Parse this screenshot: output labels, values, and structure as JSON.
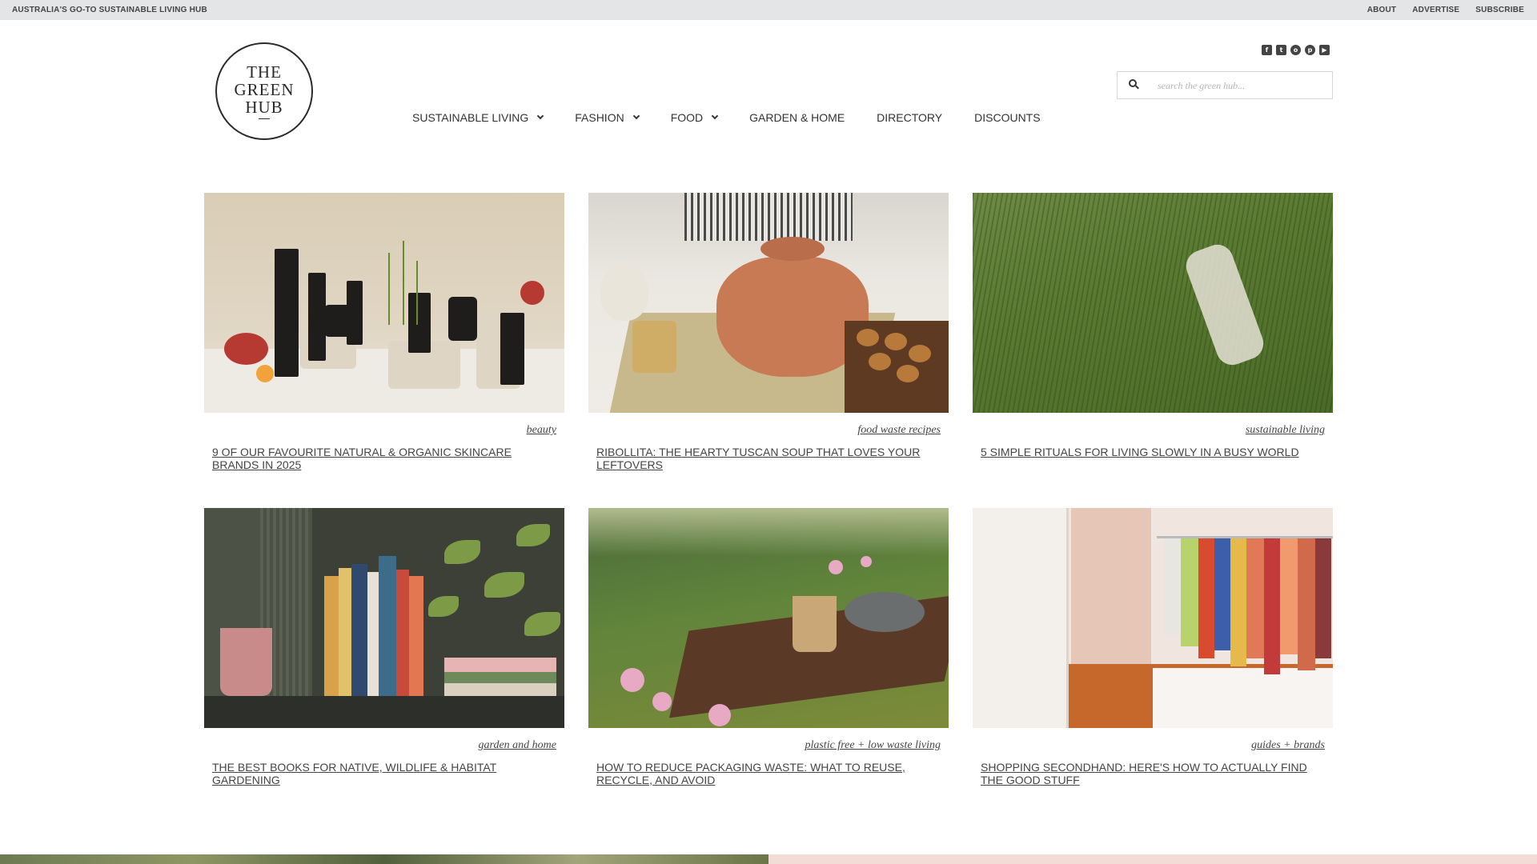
{
  "topbar": {
    "tagline": "AUSTRALIA'S GO-TO SUSTAINABLE LIVING HUB",
    "links": [
      "ABOUT",
      "ADVERTISE",
      "SUBSCRIBE"
    ]
  },
  "logo": {
    "line1": "THE",
    "line2": "GREEN",
    "line3": "HUB"
  },
  "social": [
    "facebook-icon",
    "twitter-icon",
    "instagram-icon",
    "pinterest-icon",
    "youtube-icon"
  ],
  "search": {
    "placeholder": "search the green hub..."
  },
  "nav": {
    "items": [
      {
        "label": "SUSTAINABLE LIVING",
        "has_dropdown": true
      },
      {
        "label": "FASHION",
        "has_dropdown": true
      },
      {
        "label": "FOOD",
        "has_dropdown": true
      },
      {
        "label": "GARDEN & HOME",
        "has_dropdown": false
      },
      {
        "label": "DIRECTORY",
        "has_dropdown": false
      },
      {
        "label": "DISCOUNTS",
        "has_dropdown": false
      }
    ]
  },
  "articles": [
    {
      "category": "beauty",
      "title": "9 OF OUR FAVOURITE NATURAL & ORGANIC SKINCARE BRANDS IN 2025"
    },
    {
      "category": "food waste recipes",
      "title": "RIBOLLITA: THE HEARTY TUSCAN SOUP THAT LOVES YOUR LEFTOVERS"
    },
    {
      "category": "sustainable living",
      "title": "5 SIMPLE RITUALS FOR LIVING SLOWLY IN A BUSY WORLD"
    },
    {
      "category": "garden and home",
      "title": "THE BEST BOOKS FOR NATIVE, WILDLIFE & HABITAT GARDENING"
    },
    {
      "category": "plastic free + low waste living",
      "title": "HOW TO REDUCE PACKAGING WASTE: WHAT TO REUSE, RECYCLE, AND AVOID"
    },
    {
      "category": "guides + brands",
      "title": "SHOPPING SECONDHAND: HERE'S HOW TO ACTUALLY FIND THE GOOD STUFF"
    }
  ]
}
